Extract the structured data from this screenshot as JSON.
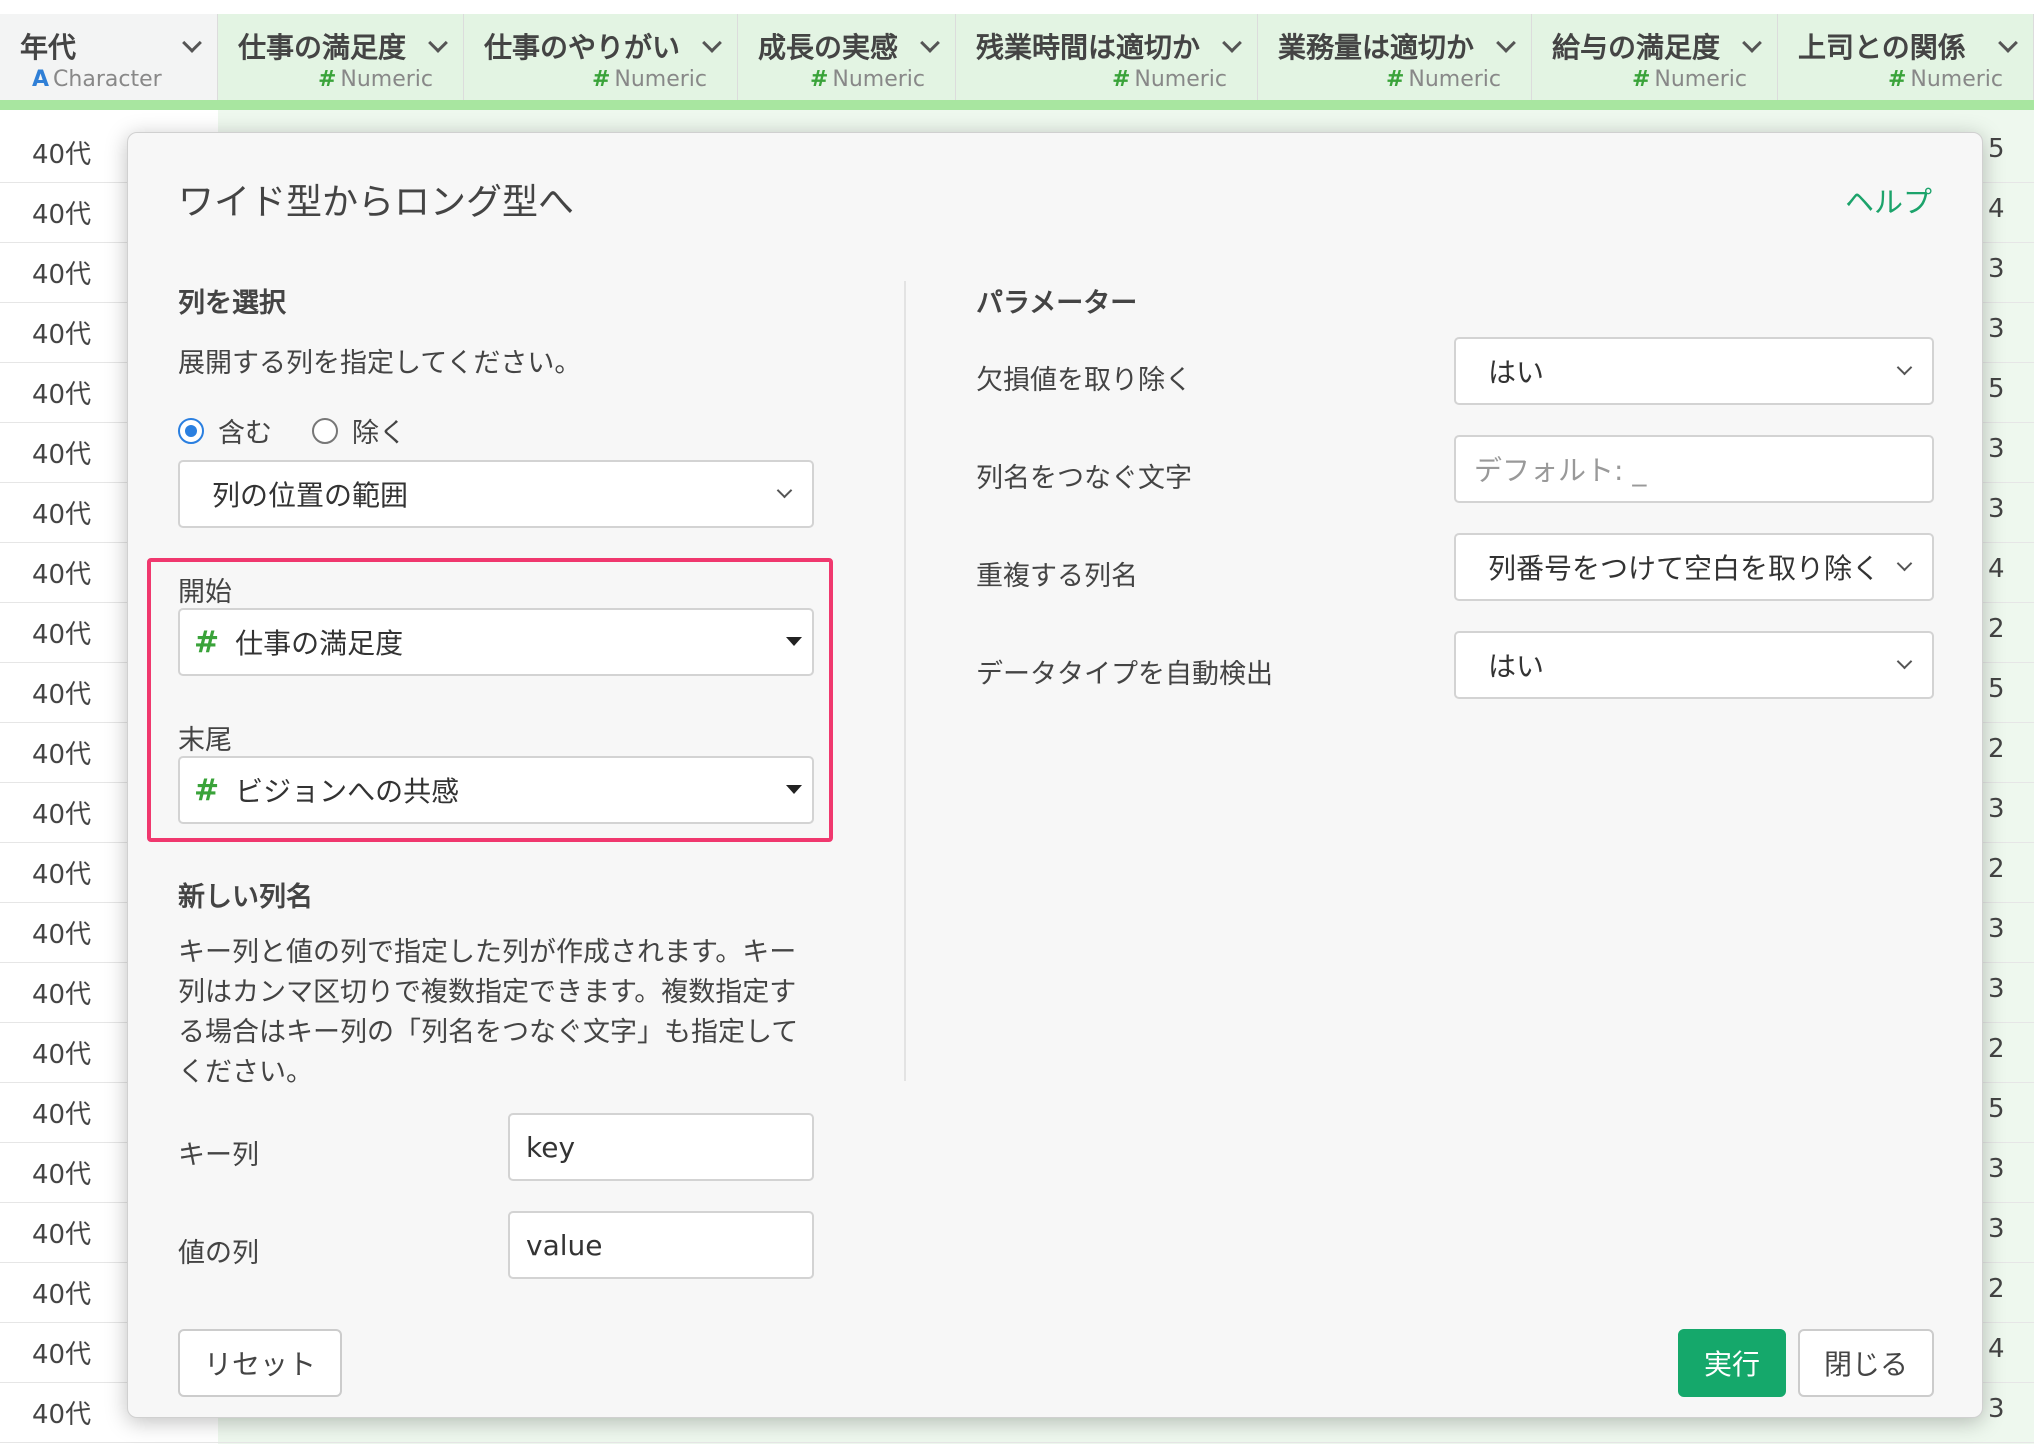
{
  "grid": {
    "columns": [
      {
        "name": "年代",
        "type": "Character",
        "type_icon": "A"
      },
      {
        "name": "仕事の満足度",
        "type": "Numeric",
        "type_icon": "#"
      },
      {
        "name": "仕事のやりがい",
        "type": "Numeric",
        "type_icon": "#"
      },
      {
        "name": "成長の実感",
        "type": "Numeric",
        "type_icon": "#"
      },
      {
        "name": "残業時間は適切か",
        "type": "Numeric",
        "type_icon": "#"
      },
      {
        "name": "業務量は適切か",
        "type": "Numeric",
        "type_icon": "#"
      },
      {
        "name": "給与の満足度",
        "type": "Numeric",
        "type_icon": "#"
      },
      {
        "name": "上司との関係",
        "type": "Numeric",
        "type_icon": "#"
      }
    ],
    "rows": [
      {
        "age": "40代",
        "last": "5"
      },
      {
        "age": "40代",
        "last": "4"
      },
      {
        "age": "40代",
        "last": "3"
      },
      {
        "age": "40代",
        "last": "3"
      },
      {
        "age": "40代",
        "last": "5"
      },
      {
        "age": "40代",
        "last": "3"
      },
      {
        "age": "40代",
        "last": "3"
      },
      {
        "age": "40代",
        "last": "4"
      },
      {
        "age": "40代",
        "last": "2"
      },
      {
        "age": "40代",
        "last": "5"
      },
      {
        "age": "40代",
        "last": "2"
      },
      {
        "age": "40代",
        "last": "3"
      },
      {
        "age": "40代",
        "last": "2"
      },
      {
        "age": "40代",
        "last": "3"
      },
      {
        "age": "40代",
        "last": "3"
      },
      {
        "age": "40代",
        "last": "2"
      },
      {
        "age": "40代",
        "last": "5"
      },
      {
        "age": "40代",
        "last": "3"
      },
      {
        "age": "40代",
        "last": "3"
      },
      {
        "age": "40代",
        "last": "2"
      },
      {
        "age": "40代",
        "last": "4"
      },
      {
        "age": "40代",
        "last": "3"
      }
    ]
  },
  "dialog": {
    "title": "ワイド型からロング型へ",
    "help": "ヘルプ",
    "select_columns": {
      "heading": "列を選択",
      "description": "展開する列を指定してください。",
      "include_label": "含む",
      "exclude_label": "除く",
      "include_selected": true,
      "mode_value": "列の位置の範囲",
      "start_label": "開始",
      "start_value": "仕事の満足度",
      "end_label": "末尾",
      "end_value": "ビジョンへの共感"
    },
    "new_columns": {
      "heading": "新しい列名",
      "description": "キー列と値の列で指定した列が作成されます。キー列はカンマ区切りで複数指定できます。複数指定する場合はキー列の「列名をつなぐ文字」も指定してください。",
      "key_label": "キー列",
      "key_value": "key",
      "value_label": "値の列",
      "value_value": "value"
    },
    "parameters": {
      "heading": "パラメーター",
      "remove_na_label": "欠損値を取り除く",
      "remove_na_value": "はい",
      "separator_label": "列名をつなぐ文字",
      "separator_placeholder": "デフォルト: _",
      "duplicate_label": "重複する列名",
      "duplicate_value": "列番号をつけて空白を取り除く",
      "auto_type_label": "データタイプを自動検出",
      "auto_type_value": "はい"
    },
    "buttons": {
      "reset": "リセット",
      "run": "実行",
      "close": "閉じる"
    },
    "colors": {
      "accent": "#15a86b",
      "highlight": "#f0386e",
      "numeric_icon": "#3aa33a"
    }
  }
}
